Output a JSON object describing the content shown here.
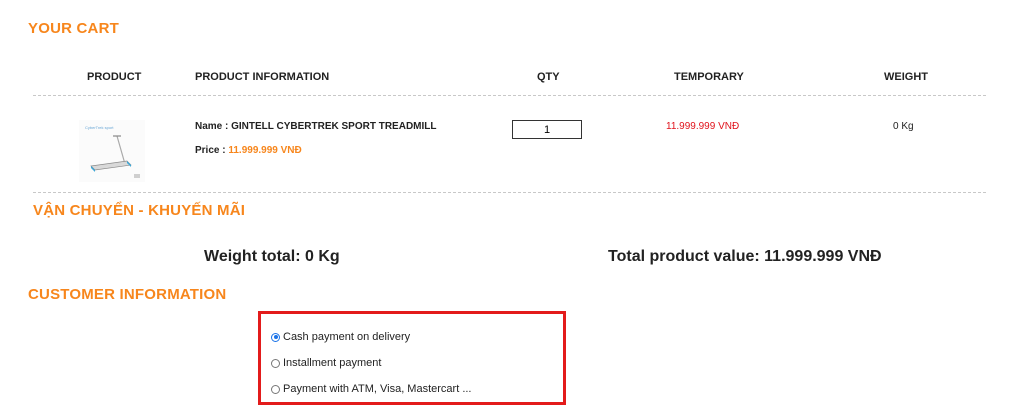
{
  "cart": {
    "title": "YOUR CART",
    "columns": {
      "product": "PRODUCT",
      "info": "PRODUCT INFORMATION",
      "qty": "QTY",
      "temporary": "TEMPORARY",
      "weight": "WEIGHT"
    },
    "item": {
      "thumb_caption": "CyberTrek sport",
      "name_label": "Name : ",
      "name": "GINTELL CYBERTREK SPORT TREADMILL",
      "price_label": "Price : ",
      "price": "11.999.999 VNĐ",
      "qty": "1",
      "temporary": "11.999.999 VNĐ",
      "weight": "0 Kg"
    }
  },
  "shipping": {
    "title": "VẬN CHUYỂN - KHUYẾN MÃI",
    "weight_total": "Weight total: 0 Kg",
    "total_value": "Total product value: 11.999.999 VNĐ"
  },
  "customer": {
    "title": "CUSTOMER INFORMATION",
    "payment_options": [
      {
        "label": "Cash payment on delivery",
        "selected": true
      },
      {
        "label": "Installment payment",
        "selected": false
      },
      {
        "label": "Payment with ATM, Visa, Mastercart ...",
        "selected": false
      }
    ]
  },
  "colors": {
    "accent": "#f7861c",
    "price_red": "#e0121b",
    "highlight_box": "#e31b1b",
    "radio_selected": "#1a73e8"
  }
}
